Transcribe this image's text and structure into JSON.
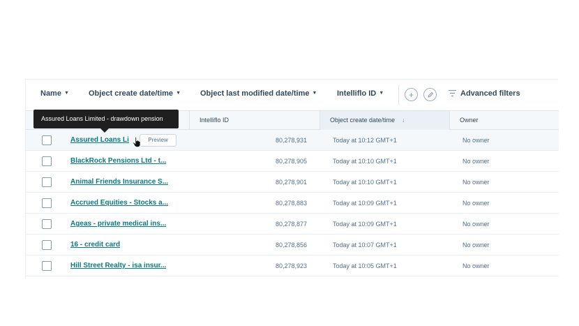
{
  "toolbar": {
    "filters": [
      {
        "label": "Name"
      },
      {
        "label": "Object create date/time"
      },
      {
        "label": "Object last modified date/time"
      },
      {
        "label": "Intelliflo ID"
      }
    ],
    "add_icon": "plus-icon",
    "edit_icon": "pencil-icon",
    "advanced_filters_label": "Advanced filters"
  },
  "table": {
    "columns": [
      "Intelliflo ID",
      "Object create date/time",
      "Owner"
    ],
    "sort_indicator": "↓",
    "tooltip": "Assured Loans Limited - drawdown pension",
    "preview_label": "Preview",
    "rows": [
      {
        "name": "Assured Loans Li",
        "id": "80,278,931",
        "date": "Today at 10:12 GMT+1",
        "owner": "No owner"
      },
      {
        "name": "BlackRock Pensions Ltd - t...",
        "id": "80,278,905",
        "date": "Today at 10:10 GMT+1",
        "owner": "No owner"
      },
      {
        "name": "Animal Friends Insurance S...",
        "id": "80,278,901",
        "date": "Today at 10:10 GMT+1",
        "owner": "No owner"
      },
      {
        "name": "Accrued Equities - Stocks a...",
        "id": "80,278,883",
        "date": "Today at 10:09 GMT+1",
        "owner": "No owner"
      },
      {
        "name": "Ageas - private medical ins...",
        "id": "80,278,877",
        "date": "Today at 10:09 GMT+1",
        "owner": "No owner"
      },
      {
        "name": "16 - credit card",
        "id": "80,278,856",
        "date": "Today at 10:07 GMT+1",
        "owner": "No owner"
      },
      {
        "name": "Hill Street Realty - isa insur...",
        "id": "80,278,923",
        "date": "Today at 10:05 GMT+1",
        "owner": "No owner"
      }
    ]
  },
  "colors": {
    "link": "#0a7a84",
    "tooltip_bg": "#1f1f1f",
    "header_bg": "#f5f8fa"
  }
}
